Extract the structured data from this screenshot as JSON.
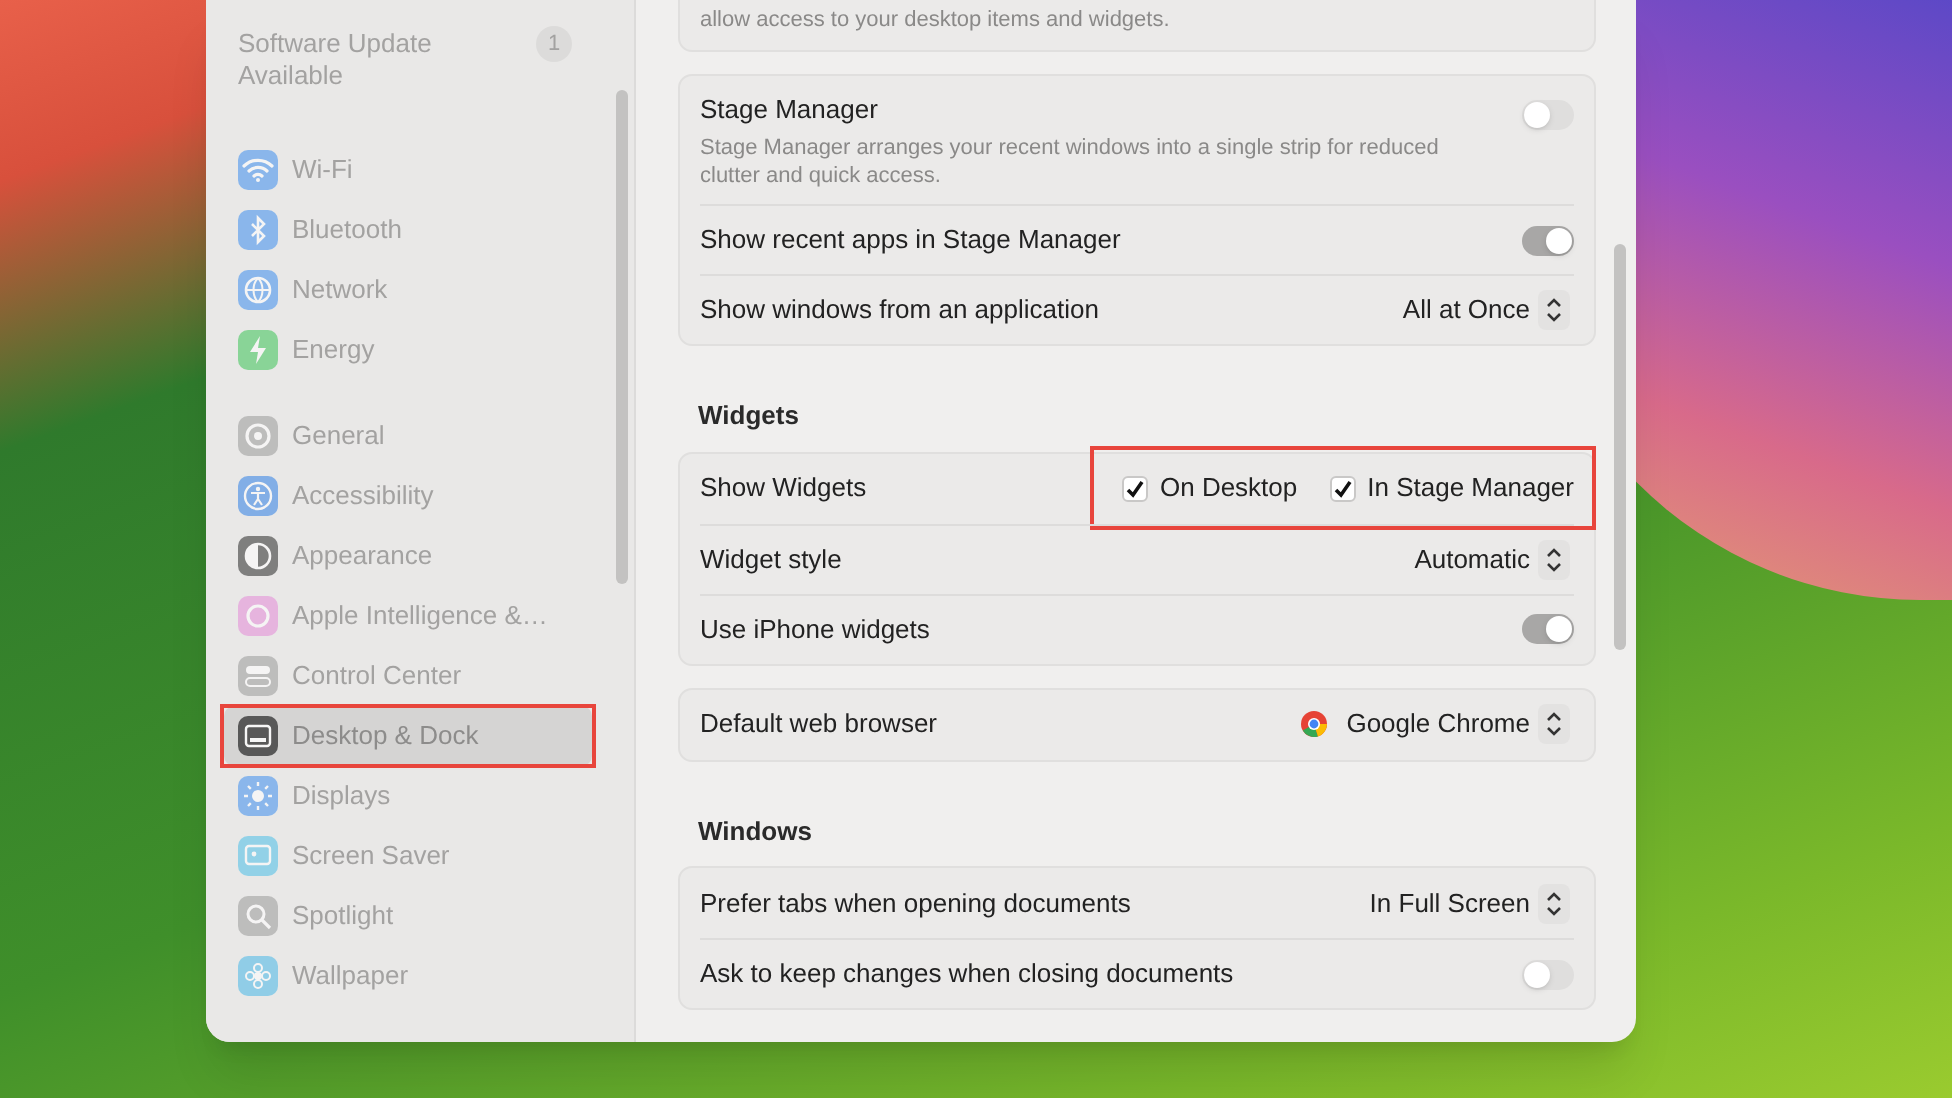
{
  "sidebar": {
    "update": {
      "label": "Software Update Available",
      "badge": "1"
    },
    "groups": [
      [
        {
          "label": "Wi-Fi",
          "selected": false
        },
        {
          "label": "Bluetooth",
          "selected": false
        },
        {
          "label": "Network",
          "selected": false
        },
        {
          "label": "Energy",
          "selected": false
        }
      ],
      [
        {
          "label": "General",
          "selected": false
        },
        {
          "label": "Accessibility",
          "selected": false
        },
        {
          "label": "Appearance",
          "selected": false
        },
        {
          "label": "Apple Intelligence &…",
          "selected": false
        },
        {
          "label": "Control Center",
          "selected": false
        },
        {
          "label": "Desktop & Dock",
          "selected": true,
          "highlighted": true
        },
        {
          "label": "Displays",
          "selected": false
        },
        {
          "label": "Screen Saver",
          "selected": false
        },
        {
          "label": "Spotlight",
          "selected": false
        },
        {
          "label": "Wallpaper",
          "selected": false
        }
      ]
    ]
  },
  "content": {
    "sections": [
      {
        "cards": [
          {
            "rows": [
              {
                "kind": "note",
                "description": "allow access to your desktop items and widgets."
              }
            ]
          },
          {
            "rows": [
              {
                "kind": "toggle",
                "label": "Stage Manager",
                "description": "Stage Manager arranges your recent windows into a single strip for reduced clutter and quick access.",
                "on": false
              },
              {
                "kind": "toggle",
                "label": "Show recent apps in Stage Manager",
                "on": true
              },
              {
                "kind": "popup",
                "label": "Show windows from an application",
                "value": "All at Once"
              }
            ]
          }
        ]
      },
      {
        "heading": "Widgets",
        "cards": [
          {
            "rows": [
              {
                "kind": "checkboxes",
                "label": "Show Widgets",
                "highlighted": true,
                "options": [
                  {
                    "label": "On Desktop",
                    "checked": true
                  },
                  {
                    "label": "In Stage Manager",
                    "checked": true
                  }
                ]
              },
              {
                "kind": "popup",
                "label": "Widget style",
                "value": "Automatic"
              },
              {
                "kind": "toggle",
                "label": "Use iPhone widgets",
                "on": true
              }
            ]
          },
          {
            "rows": [
              {
                "kind": "app_popup",
                "label": "Default web browser",
                "value": "Google Chrome"
              }
            ]
          }
        ]
      },
      {
        "heading": "Windows",
        "cards": [
          {
            "rows": [
              {
                "kind": "popup",
                "label": "Prefer tabs when opening documents",
                "value": "In Full Screen"
              },
              {
                "kind": "toggle",
                "label": "Ask to keep changes when closing documents",
                "on": false
              }
            ]
          }
        ]
      }
    ]
  }
}
